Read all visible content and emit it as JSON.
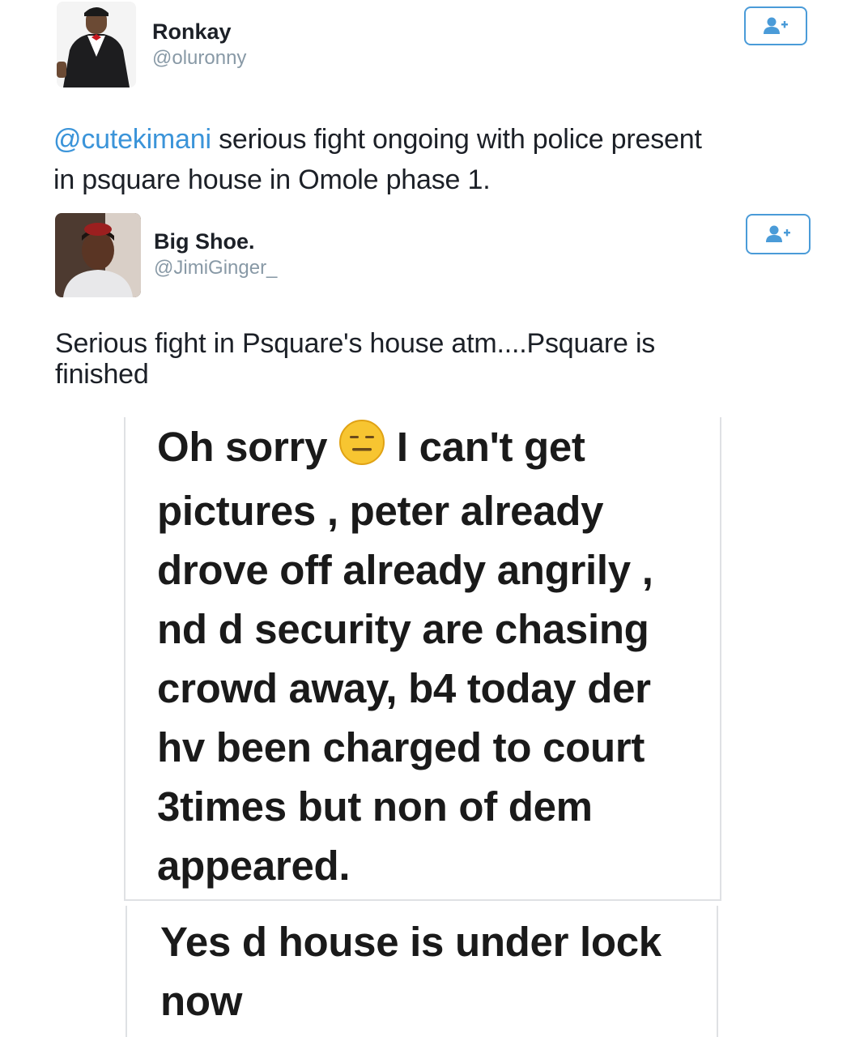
{
  "tweets": [
    {
      "name": "Ronkay",
      "handle": "@oluronny",
      "mention": "@cutekimani",
      "text_line1": " serious fight ongoing with police present",
      "text_line2": "in psquare house in Omole phase 1."
    },
    {
      "name": "Big Shoe.",
      "handle": "@JimiGinger_",
      "text_line1": "Serious fight in Psquare's house atm....Psquare is",
      "text_line2": "finished"
    }
  ],
  "chat": {
    "message1": {
      "line1_start": "Oh sorry ",
      "emoji": "neutral-face-emoji",
      "line1_end": " I can't get",
      "line2": "pictures , peter already",
      "line3": "drove off already angrily ,",
      "line4": "nd d security are chasing",
      "line5": "crowd away, b4 today der",
      "line6": "hv been charged to court",
      "line7": "3times but non of dem",
      "line8": "appeared."
    },
    "message2": {
      "line1": "Yes d house is under lock",
      "line2": "now"
    }
  },
  "colors": {
    "mention": "#3b94d9",
    "follow_border": "#4a9bd8",
    "handle": "#8899a6"
  }
}
